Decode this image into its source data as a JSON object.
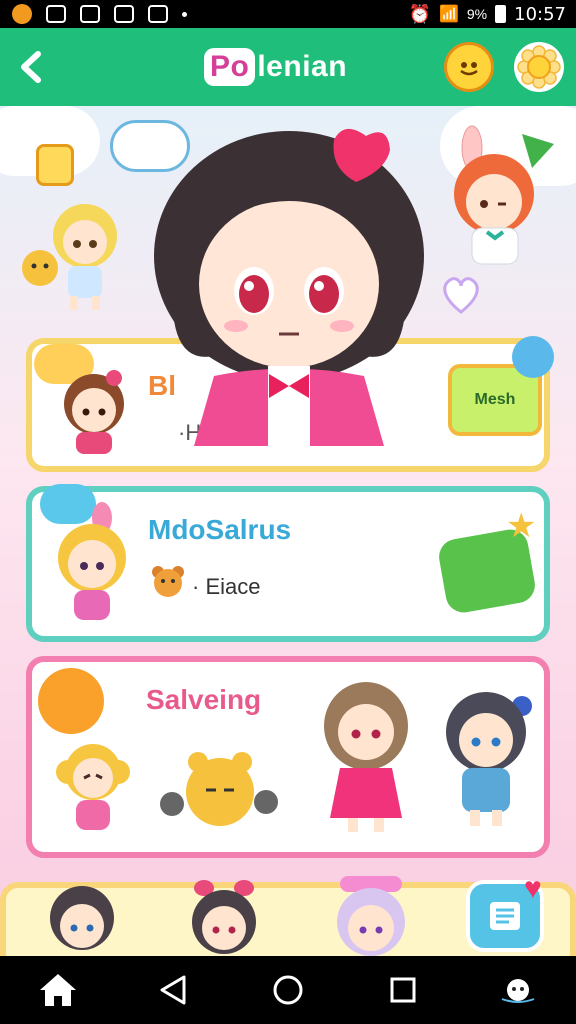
{
  "status_bar": {
    "battery": "9%",
    "time": "10:57"
  },
  "header": {
    "title_logo": "Po",
    "title_rest": "lenian"
  },
  "cards": [
    {
      "title": "Bl",
      "subtitle": "·Hap",
      "badge": "Mesh"
    },
    {
      "title": "MdoSalrus",
      "subtitle": "· Eiace"
    },
    {
      "title": "Salveing"
    }
  ],
  "colors": {
    "header": "#1fbf7b",
    "accent_pink": "#e85a8c",
    "accent_blue": "#39a9d7"
  },
  "icons": {
    "back": "chevron-left-icon",
    "chat": "chat-bubble-icon",
    "settings": "gear-icon",
    "fab": "notes-icon",
    "nav": [
      "home-icon",
      "back-triangle-icon",
      "circle-home-icon",
      "square-recents-icon",
      "assistant-icon"
    ]
  }
}
